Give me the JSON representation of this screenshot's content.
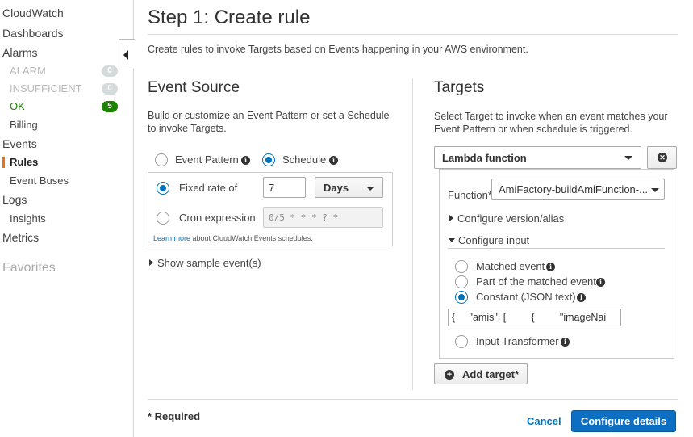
{
  "sidebar": {
    "items": [
      {
        "label": "CloudWatch"
      },
      {
        "label": "Dashboards"
      },
      {
        "label": "Alarms"
      },
      {
        "label": "ALARM",
        "count": "0"
      },
      {
        "label": "INSUFFICIENT",
        "count": "0"
      },
      {
        "label": "OK",
        "count": "5"
      },
      {
        "label": "Billing"
      },
      {
        "label": "Events"
      },
      {
        "label": "Rules"
      },
      {
        "label": "Event Buses"
      },
      {
        "label": "Logs"
      },
      {
        "label": "Insights"
      },
      {
        "label": "Metrics"
      },
      {
        "label": "Favorites"
      }
    ],
    "active_color": "#ec7211"
  },
  "page": {
    "title": "Step 1: Create rule",
    "intro": "Create rules to invoke Targets based on Events happening in your AWS environment."
  },
  "event_source": {
    "title": "Event Source",
    "description_line1": "Build or customize an Event Pattern or set a Schedule",
    "description_line2": "to invoke Targets.",
    "option_pattern": "Event Pattern",
    "option_schedule": "Schedule",
    "fixed_rate_label": "Fixed rate of",
    "fixed_rate_value": "7",
    "rate_unit": "Days",
    "cron_label": "Cron expression",
    "cron_placeholder": "0/5 * * * ? *",
    "learn_more_link": "Learn more",
    "learn_more_text": " about CloudWatch Events schedules.",
    "show_sample": "Show sample event(s)"
  },
  "targets": {
    "title": "Targets",
    "description_line1": "Select Target to invoke when an event matches your",
    "description_line2": "Event Pattern or when schedule is triggered.",
    "target_type": "Lambda function",
    "function_label": "Function*",
    "function_value": "AmiFactory-buildAmiFunction-...",
    "configure_version": "Configure version/alias",
    "configure_input": "Configure input",
    "input_options": {
      "matched": "Matched event",
      "part": "Part of the matched event",
      "constant": "Constant (JSON text)",
      "transformer": "Input Transformer"
    },
    "json_value": "{     \"amis\": [         {         \"imageNai",
    "add_target": "Add target*"
  },
  "footer": {
    "required": "* Required",
    "cancel": "Cancel",
    "configure_details": "Configure details"
  },
  "colors": {
    "primary": "#0d6fc4",
    "link": "#0073bb",
    "ok_green": "#1d8102"
  }
}
